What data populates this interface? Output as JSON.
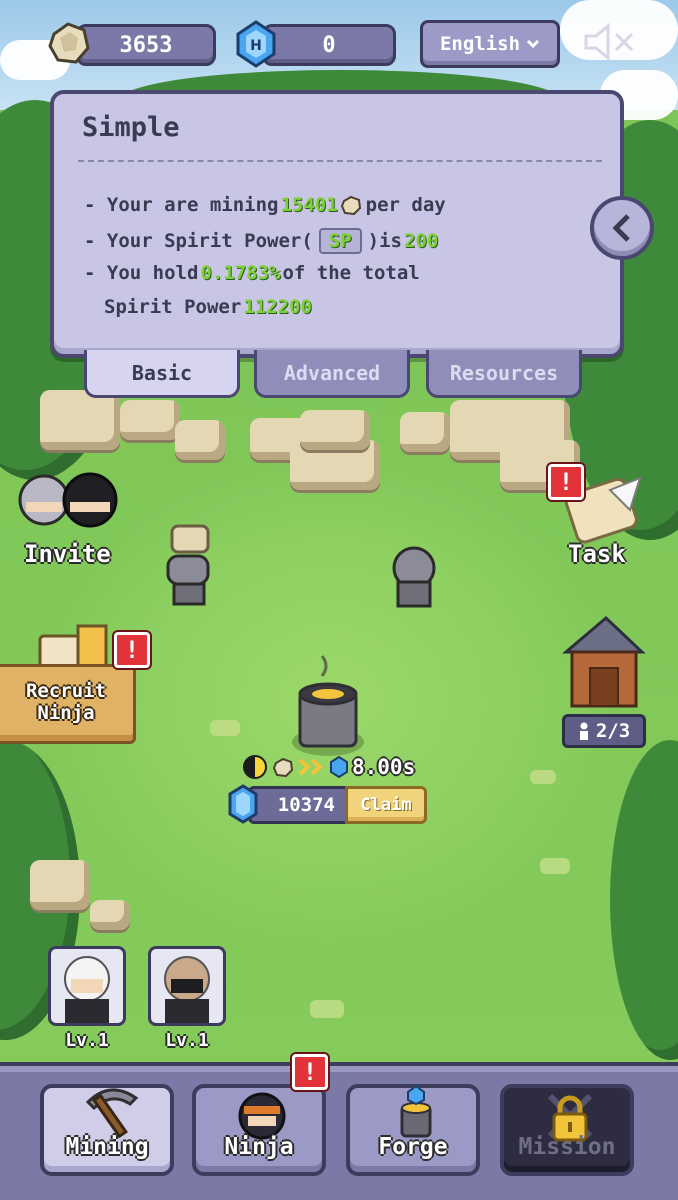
{
  "header": {
    "coins": "3653",
    "gems": "0",
    "language": "English",
    "icons": {
      "coin": "stone-coin-icon",
      "gem": "blue-gem-icon",
      "mute": "speaker-muted-icon",
      "dropdown": "chevron-down-icon"
    }
  },
  "panel": {
    "title": "Simple",
    "line1_prefix": "- Your are mining",
    "line1_value": "15401",
    "line1_suffix": "per day",
    "line2_prefix": "- Your Spirit Power(",
    "line2_sp": "SP",
    "line2_mid": ")is",
    "line2_value": "200",
    "line3_prefix": "- You hold",
    "line3_value": "0.1783%",
    "line3_suffix": "of the total",
    "line4_prefix": "Spirit Power",
    "line4_value": "112200",
    "tabs": [
      {
        "label": "Basic",
        "active": true
      },
      {
        "label": "Advanced",
        "active": false
      },
      {
        "label": "Resources",
        "active": false
      }
    ]
  },
  "side": {
    "invite_label": "Invite",
    "task_label": "Task",
    "recruit_label_1": "Recruit",
    "recruit_label_2": "Ninja",
    "capacity": "2/3",
    "alert_mark": "!"
  },
  "forge": {
    "timer": "8.00s",
    "claim_amount": "10374",
    "claim_label": "Claim"
  },
  "ninjas": [
    {
      "level": "Lv.1"
    },
    {
      "level": "Lv.1"
    }
  ],
  "nav": [
    {
      "label": "Mining",
      "icon": "pickaxe-icon",
      "state": "active"
    },
    {
      "label": "Ninja",
      "icon": "ninja-head-icon",
      "state": "normal"
    },
    {
      "label": "Forge",
      "icon": "forge-icon",
      "state": "normal"
    },
    {
      "label": "Mission",
      "icon": "lock-icon",
      "state": "locked"
    }
  ],
  "colors": {
    "panel": "#c8c6e4",
    "highlight": "#7fcf3c",
    "alert": "#e2323a",
    "grass": "#8fd062"
  }
}
